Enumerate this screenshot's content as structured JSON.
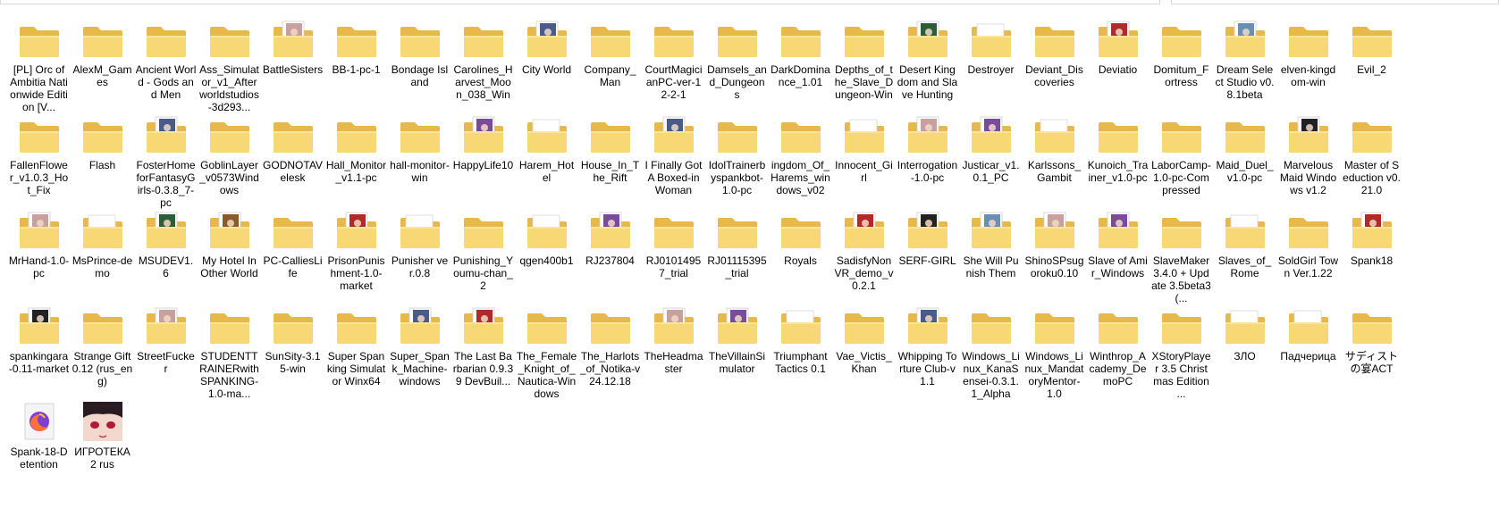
{
  "items": [
    {
      "label": "[PL] Orc of Ambitia Nationwide Edition [V...",
      "icon": "folder-icon"
    },
    {
      "label": "AlexM_Games",
      "icon": "folder-icon"
    },
    {
      "label": "Ancient World - Gods and Men",
      "icon": "folder-icon"
    },
    {
      "label": "Ass_Simulator_v1_Afterworldstudios-3d293...",
      "icon": "folder-icon"
    },
    {
      "label": "BattleSisters",
      "icon": "folder-image-icon"
    },
    {
      "label": "BB-1-pc-1",
      "icon": "folder-icon"
    },
    {
      "label": "Bondage Island",
      "icon": "folder-icon"
    },
    {
      "label": "Carolines_Harvest_Moon_038_Win",
      "icon": "folder-icon"
    },
    {
      "label": "City World",
      "icon": "folder-image-icon"
    },
    {
      "label": "Company_Man",
      "icon": "folder-icon"
    },
    {
      "label": "CourtMagicianPC-ver-12-2-1",
      "icon": "folder-icon"
    },
    {
      "label": "Damsels_and_Dungeons",
      "icon": "folder-icon"
    },
    {
      "label": "DarkDominance_1.01",
      "icon": "folder-icon"
    },
    {
      "label": "Depths_of_the_Slave_Dungeon-Win",
      "icon": "folder-icon"
    },
    {
      "label": "Desert Kingdom and Slave Hunting",
      "icon": "folder-image-icon"
    },
    {
      "label": "Destroyer",
      "icon": "folder-paper-icon"
    },
    {
      "label": "Deviant_Discoveries",
      "icon": "folder-icon"
    },
    {
      "label": "Deviatio",
      "icon": "folder-image-icon"
    },
    {
      "label": "Domitum_Fortress",
      "icon": "folder-icon"
    },
    {
      "label": "Dream Select Studio v0.8.1beta",
      "icon": "folder-image-icon"
    },
    {
      "label": "elven-kingdom-win",
      "icon": "folder-icon"
    },
    {
      "label": "Evil_2",
      "icon": "folder-icon"
    },
    {
      "label": "FallenFlower_v1.0.3_Hot_Fix",
      "icon": "folder-icon"
    },
    {
      "label": "Flash",
      "icon": "folder-icon"
    },
    {
      "label": "FosterHomeforFantasyGirls-0.3.8_7-pc",
      "icon": "folder-image-icon"
    },
    {
      "label": "GoblinLayer_v0573Windows",
      "icon": "folder-icon"
    },
    {
      "label": "GODNOTAVelesk",
      "icon": "folder-icon"
    },
    {
      "label": "Hall_Monitor_v1.1-pc",
      "icon": "folder-icon"
    },
    {
      "label": "hall-monitor-win",
      "icon": "folder-icon"
    },
    {
      "label": "HappyLife10",
      "icon": "folder-image-icon"
    },
    {
      "label": "Harem_Hotel",
      "icon": "folder-paper-icon"
    },
    {
      "label": "House_In_The_Rift",
      "icon": "folder-icon"
    },
    {
      "label": "I Finally Got A Boxed-in Woman",
      "icon": "folder-image-icon"
    },
    {
      "label": "IdolTrainerbyspankbot-1.0-pc",
      "icon": "folder-icon"
    },
    {
      "label": "ingdom_Of_Harems_windows_v02",
      "icon": "folder-icon"
    },
    {
      "label": "Innocent_Girl",
      "icon": "folder-paper-icon"
    },
    {
      "label": "Interrogation-1.0-pc",
      "icon": "folder-image-icon"
    },
    {
      "label": "Justicar_v1.0.1_PC",
      "icon": "folder-image-icon"
    },
    {
      "label": "Karlssons_Gambit",
      "icon": "folder-paper-icon"
    },
    {
      "label": "Kunoich_Trainer_v1.0-pc",
      "icon": "folder-icon"
    },
    {
      "label": "LaborCamp-1.0-pc-Compressed",
      "icon": "folder-icon"
    },
    {
      "label": "Maid_Duel_v1.0-pc",
      "icon": "folder-icon"
    },
    {
      "label": "Marvelous Maid Windows v1.2",
      "icon": "folder-image-icon"
    },
    {
      "label": "Master of Seduction v0.21.0",
      "icon": "folder-icon"
    },
    {
      "label": "MrHand-1.0-pc",
      "icon": "folder-image-icon"
    },
    {
      "label": "MsPrince-demo",
      "icon": "folder-paper-icon"
    },
    {
      "label": "MSUDEV1.6",
      "icon": "folder-image-icon"
    },
    {
      "label": "My Hotel In Other World",
      "icon": "folder-image-icon"
    },
    {
      "label": "PC-CalliesLife",
      "icon": "folder-icon"
    },
    {
      "label": "PrisonPunishment-1.0-market",
      "icon": "folder-image-icon"
    },
    {
      "label": "Punisher ver.0.8",
      "icon": "folder-paper-icon"
    },
    {
      "label": "Punishing_Youmu-chan_2",
      "icon": "folder-icon"
    },
    {
      "label": "qgen400b1",
      "icon": "folder-paper-icon"
    },
    {
      "label": "RJ237804",
      "icon": "folder-image-icon"
    },
    {
      "label": "RJ01014957_trial",
      "icon": "folder-icon"
    },
    {
      "label": "RJ01115395_trial",
      "icon": "folder-icon"
    },
    {
      "label": "Royals",
      "icon": "folder-icon"
    },
    {
      "label": "SadisfyNonVR_demo_v0.2.1",
      "icon": "folder-image-icon"
    },
    {
      "label": "SERF-GIRL",
      "icon": "folder-image-icon"
    },
    {
      "label": "She Will Punish Them",
      "icon": "folder-image-icon"
    },
    {
      "label": "ShinoSPsugoroku0.10",
      "icon": "folder-image-icon"
    },
    {
      "label": "Slave of Amir_Windows",
      "icon": "folder-image-icon"
    },
    {
      "label": "SlaveMaker 3.4.0 + Update 3.5beta3 (...",
      "icon": "folder-icon"
    },
    {
      "label": "Slaves_of_Rome",
      "icon": "folder-paper-icon"
    },
    {
      "label": "SoldGirl Town Ver.1.22",
      "icon": "folder-icon"
    },
    {
      "label": "Spank18",
      "icon": "folder-image-icon"
    },
    {
      "label": "spankingara-0.11-market",
      "icon": "folder-image-icon"
    },
    {
      "label": "Strange Gift 0.12 (rus_eng)",
      "icon": "folder-icon"
    },
    {
      "label": "StreetFucker",
      "icon": "folder-image-icon"
    },
    {
      "label": "STUDENTTRAINERwithSPANKING-1.0-ma...",
      "icon": "folder-icon"
    },
    {
      "label": "SunSity-3.15-win",
      "icon": "folder-icon"
    },
    {
      "label": "Super Spanking Simulator Winx64",
      "icon": "folder-icon"
    },
    {
      "label": "Super_Spank_Machine-windows",
      "icon": "folder-image-icon"
    },
    {
      "label": "The Last Barbarian 0.9.39 DevBuil...",
      "icon": "folder-image-icon"
    },
    {
      "label": "The_Female_Knight_of_Nautica-Windows",
      "icon": "folder-icon"
    },
    {
      "label": "The_Harlots_of_Notika-v24.12.18",
      "icon": "folder-icon"
    },
    {
      "label": "TheHeadmaster",
      "icon": "folder-image-icon"
    },
    {
      "label": "TheVillainSimulator",
      "icon": "folder-image-icon"
    },
    {
      "label": "Triumphant Tactics 0.1",
      "icon": "folder-paper-icon"
    },
    {
      "label": "Vae_Victis_Khan",
      "icon": "folder-icon"
    },
    {
      "label": "Whipping Torture Club-v1.1",
      "icon": "folder-image-icon"
    },
    {
      "label": "Windows_Linux_KanaSensei-0.3.1.1_Alpha",
      "icon": "folder-icon"
    },
    {
      "label": "Windows_Linux_MandatoryMentor-1.0",
      "icon": "folder-icon"
    },
    {
      "label": "Winthrop_Academy_DemoPC",
      "icon": "folder-icon"
    },
    {
      "label": "XStoryPlayer 3.5 Christmas Edition ...",
      "icon": "folder-icon"
    },
    {
      "label": "ЗЛО",
      "icon": "folder-paper-icon"
    },
    {
      "label": "Падчерица",
      "icon": "folder-paper-icon"
    },
    {
      "label": "サディストの宴ACT",
      "icon": "folder-icon"
    },
    {
      "label": "Spank-18-Detention",
      "icon": "firefox-shortcut-icon"
    },
    {
      "label": "ИГРОТЕКА 2 rus",
      "icon": "anime-image-icon"
    }
  ]
}
